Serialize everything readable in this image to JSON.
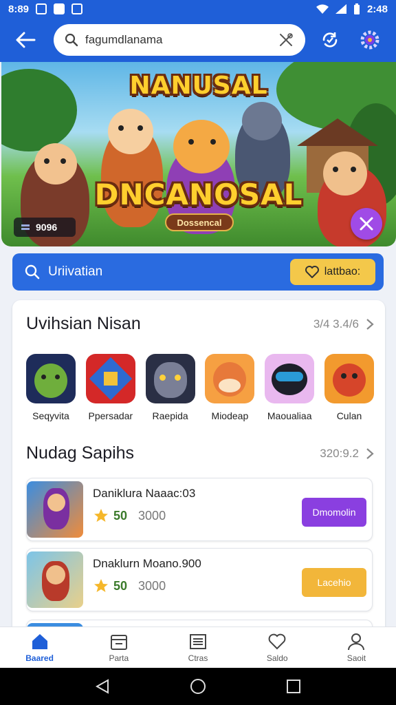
{
  "status_bar": {
    "time_left": "8:89",
    "time_right": "2:48"
  },
  "app_bar": {
    "search_text": "fagumdlanama",
    "icons": [
      "back-arrow-icon",
      "search-icon",
      "clear-icon",
      "sync-icon",
      "settings-icon"
    ]
  },
  "banner": {
    "title_top": "NANUSAL",
    "title_main": "DNCANOSAL",
    "subtitle": "Dossencal",
    "badge": "9096"
  },
  "promo": {
    "label": "Uriivatian",
    "button": "lattbao:"
  },
  "section1": {
    "title": "Uvihsian Nisan",
    "meta": "3/4 3.4/6",
    "apps": [
      {
        "name": "Seqyvita",
        "color": "#1e2c5a",
        "accent": "#6fae3c"
      },
      {
        "name": "Ppersadar",
        "color": "#d42828",
        "accent": "#2e6ad0"
      },
      {
        "name": "Raepida",
        "color": "#2a2f45",
        "accent": "#7a7f96"
      },
      {
        "name": "Miodeap",
        "color": "#f6a042",
        "accent": "#e7793a"
      },
      {
        "name": "Maoualiaa",
        "color": "#e9b8ef",
        "accent": "#2a9ad6"
      },
      {
        "name": "Culan",
        "color": "#f29a2e",
        "accent": "#d6452a"
      }
    ]
  },
  "section2": {
    "title": "Nudag Sapihs",
    "meta": "320:9.2",
    "rows": [
      {
        "title": "Daniklura Naaac:03",
        "level": "50",
        "count": "3000",
        "action": "Dmomolin",
        "action_color": "#8a3fe0"
      },
      {
        "title": "Dnaklurn Moano.900",
        "level": "50",
        "count": "3000",
        "action": "Lacehio",
        "action_color": "#f2b63a"
      }
    ]
  },
  "bottom_nav": [
    {
      "label": "Baared",
      "icon": "home-icon",
      "active": true
    },
    {
      "label": "Parta",
      "icon": "store-icon",
      "active": false
    },
    {
      "label": "Ctras",
      "icon": "list-icon",
      "active": false
    },
    {
      "label": "Saldo",
      "icon": "heart-icon",
      "active": false
    },
    {
      "label": "Saoit",
      "icon": "profile-icon",
      "active": false
    }
  ]
}
